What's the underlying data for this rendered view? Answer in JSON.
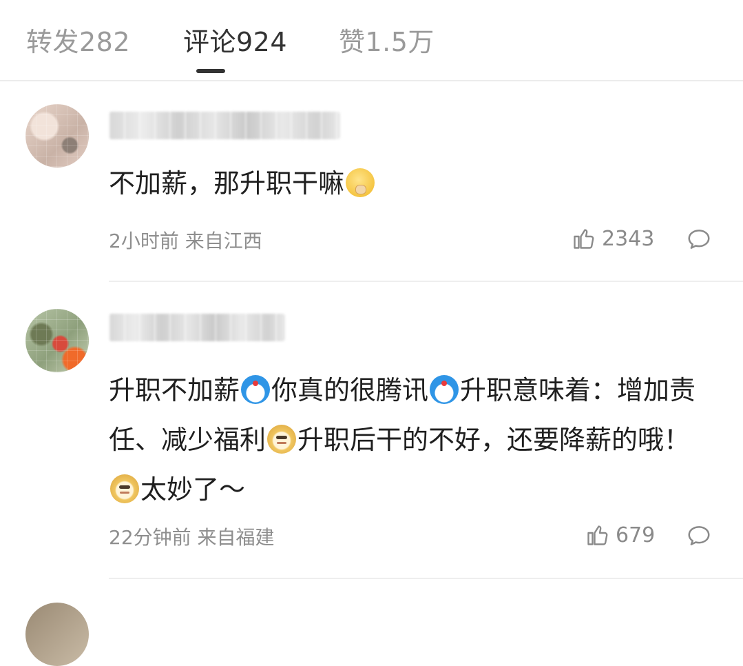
{
  "tabs": [
    {
      "label": "转发282"
    },
    {
      "label": "评论924"
    },
    {
      "label": "赞1.5万"
    }
  ],
  "active_tab_index": 1,
  "comments": [
    {
      "text_parts": [
        "不加薪，那升职干嘛"
      ],
      "time": "2小时前",
      "location": "来自江西",
      "likes": "2343"
    },
    {
      "text_parts": [
        "升职不加薪",
        "你真的很腾讯",
        "升职意味着：增加责任、减少福利",
        "升职后干的不好，还要降薪的哦！",
        "太妙了～"
      ],
      "time": "22分钟前",
      "location": "来自福建",
      "likes": "679"
    }
  ],
  "colors": {
    "active_tab": "#333333",
    "inactive_tab": "#9a9a9a",
    "meta_text": "#8e8e8e",
    "divider": "#eeeeee"
  },
  "icons": {
    "like": "thumbs-up-icon",
    "reply": "comment-bubble-icon",
    "emoji_1": "shush-face-emoji",
    "emoji_2": "doraemon-emoji",
    "emoji_3": "doge-emoji"
  }
}
